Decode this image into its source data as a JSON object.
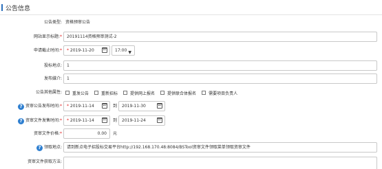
{
  "header": {
    "title": "公告信息"
  },
  "form": {
    "notice_type": {
      "label": "公告类型:",
      "value": "资格预审公告"
    },
    "display_title": {
      "label": "网站显示标题:",
      "value": "20191114资格预审测试-2"
    },
    "deadline": {
      "label": "申请截止时间:",
      "date": "2019-11-20",
      "time": "17:00"
    },
    "bid_location": {
      "label": "投标地点:",
      "value": "1"
    },
    "media": {
      "label": "发布媒介:",
      "value": "1"
    },
    "other_attrs": {
      "label": "公告其他属性:",
      "options": [
        "重发公告",
        "重新招标",
        "提供网上报名",
        "提供联合体报名",
        "需要项目负责人"
      ]
    },
    "notice_publish_time": {
      "label": "资审公告发布时间:",
      "from": "2019-11-14",
      "sep": "到",
      "to": "2019-11-30"
    },
    "doc_issue_time": {
      "label": "资审文件发售时间:",
      "from": "2019-11-14",
      "sep": "到",
      "to": "2019-11-24"
    },
    "doc_price": {
      "label": "资审文件价格:",
      "value": "0.00",
      "unit": "元"
    },
    "pickup_location": {
      "label": "领取地点:",
      "value": "请到新点电子招投标交易平台http://192.168.170.48:8084/BSTool资审文件领取菜单领取资审文件"
    },
    "obtain_method": {
      "label": "资审文件获取方法:"
    }
  },
  "icons": {
    "help": "question-circle-icon",
    "calendar": "calendar-icon",
    "dropdown": "caret-down-icon"
  },
  "colors": {
    "accent": "#2a6ebb",
    "required": "#e02020",
    "help_icon": "#2e7fd0"
  }
}
